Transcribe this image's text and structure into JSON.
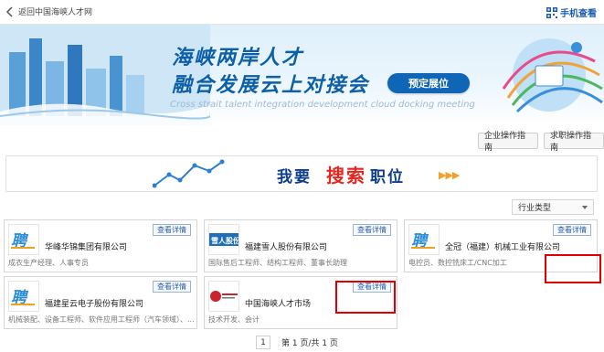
{
  "topbar": {
    "back_label": "返回中国海峡人才网",
    "qr_label": "手机查看"
  },
  "banner": {
    "title_line1": "海峡两岸人才",
    "title_line2": "融合发展云上对接会",
    "booth_button": "预定展位",
    "subtitle_en": "Cross strait talent integration development cloud docking meeting"
  },
  "guides": {
    "company": "企业操作指南",
    "jobseeker": "求职操作指南"
  },
  "search_banner": {
    "part1": "我要",
    "part2": "搜索",
    "part3": "职位",
    "arrows": "▶▶▶"
  },
  "filter": {
    "label": "行业类型"
  },
  "detail_label": "查看详情",
  "companies": [
    {
      "name": "华峰华锦集团有限公司",
      "jobs": "成衣生产经理、人事专员"
    },
    {
      "name": "福建雪人股份有限公司",
      "jobs": "国际售后工程师、结构工程师、董事长助理"
    },
    {
      "name": "全冠（福建）机械工业有限公司",
      "jobs": "电控员、数控铣床工/CNC加工"
    },
    {
      "name": "福建星云电子股份有限公司",
      "jobs": "机械装配、设备工程师、软件应用工程师（汽车领域）、..."
    },
    {
      "name": "中国海峡人才市场",
      "jobs": "技术开发、会计"
    }
  ],
  "pager": {
    "current": "1",
    "summary": "第 1 页/共 1 页"
  },
  "colors": {
    "brand": "#0d5fa8",
    "accent_red": "#e5261f",
    "highlight_box": "#e00000"
  }
}
